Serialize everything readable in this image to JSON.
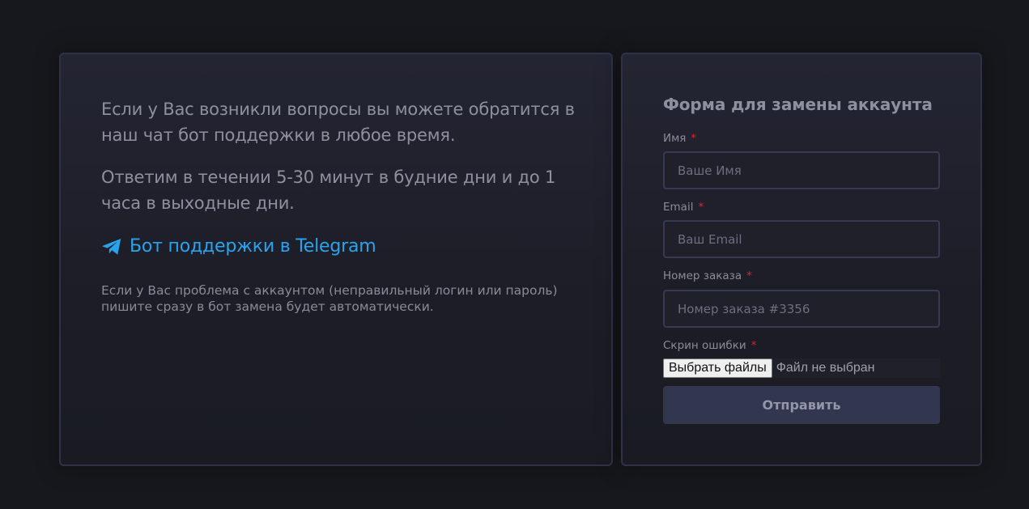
{
  "info": {
    "paragraph_1": "Если у Вас возникли вопросы вы можете обратится в наш чат бот поддержки в любое время.",
    "paragraph_2": "Ответим в течении 5-30 минут в будние дни и до 1 часа в выходные дни.",
    "telegram_link": "Бот поддержки в Telegram",
    "telegram_icon": "telegram-plane-icon",
    "note": "Если у Вас проблема с аккаунтом (неправильный логин или пароль) пишите сразу в бот замена будет автоматически."
  },
  "form": {
    "title": "Форма для замены аккаунта",
    "required_mark": "*",
    "name": {
      "label": "Имя",
      "placeholder": "Ваше Имя",
      "value": ""
    },
    "email": {
      "label": "Email",
      "placeholder": "Ваш Email",
      "value": ""
    },
    "order": {
      "label": "Номер заказа",
      "placeholder": "Номер заказа #3356",
      "value": ""
    },
    "screenshot": {
      "label": "Скрин ошибки",
      "button_label": "Выбрать файлы",
      "status": "Файл не выбран"
    },
    "submit_label": "Отправить"
  },
  "colors": {
    "background": "#17181d",
    "card_border": "#2f3246",
    "link": "#2aa3ef",
    "required": "#e0202b",
    "button": "#33364f"
  }
}
